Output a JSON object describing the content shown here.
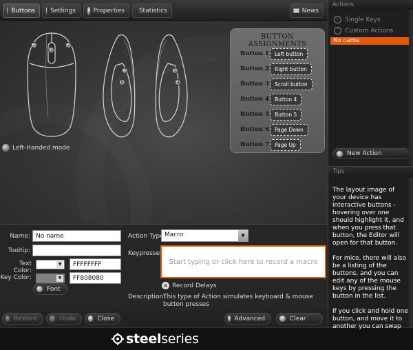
{
  "toolbar": {
    "tabs": [
      {
        "label": "Buttons",
        "active": true
      },
      {
        "label": "Settings",
        "active": false
      },
      {
        "label": "Properties",
        "active": false
      },
      {
        "label": "Statistics",
        "active": false
      }
    ],
    "news_label": "News"
  },
  "mouse_markers": {
    "top": [
      "1",
      "3",
      "2"
    ],
    "left_side": [
      "7",
      "6"
    ],
    "right_side": [
      "5",
      "4"
    ]
  },
  "assignments": {
    "title": "BUTTON ASSIGNMENTS",
    "rows": [
      {
        "label": "Button 1",
        "value": "Left button"
      },
      {
        "label": "Button 2",
        "value": "Right button"
      },
      {
        "label": "Button 3",
        "value": "Scroll button"
      },
      {
        "label": "Button 4",
        "value": "Button 4"
      },
      {
        "label": "Button 5",
        "value": "Button 5"
      },
      {
        "label": "Button 6",
        "value": "Page Down"
      },
      {
        "label": "Button 7",
        "value": "Page Up"
      }
    ]
  },
  "left_handed_label": "Left-Handed mode",
  "form": {
    "name_label": "Name:",
    "name_value": "No name",
    "tooltip_label": "Tooltip:",
    "tooltip_value": "",
    "text_color_label": "Text Color:",
    "text_color_value": "FFFFFFFF",
    "key_color_label": "Key Color:",
    "key_color_value": "FF808080",
    "font_label": "Font",
    "action_type_label": "Action Type",
    "action_type_value": "Macro",
    "keypresses_label": "Keypresses:",
    "keypresses_placeholder": "Start typing or click here to record a macro",
    "record_delays_label": "Record Delays",
    "description_label": "Description:",
    "description_text": "This type of Action simulates keyboard & mouse button presses"
  },
  "bottom": {
    "restore": "Restore",
    "undo": "Undo",
    "close": "Close",
    "advanced": "Advanced",
    "clear": "Clear"
  },
  "brand": {
    "bold": "steel",
    "thin": "series"
  },
  "right_panel": {
    "actions_header": "Actions",
    "single_keys": "Single Keys",
    "custom_actions": "Custom Actions",
    "selected_action": "No name",
    "new_action": "New Action",
    "tips_header": "Tips",
    "tips": [
      "The layout image of your device has interactive buttons - hovering over one should highlight it, and when you press that button, the Editor will open for that button.",
      "For mice, there will also be a listing of the buttons, and you can edit any of the mouse keys by pressing the button in the list.",
      "If you click and hold one button, and move it to another you can swap"
    ]
  },
  "colors": {
    "accent": "#e05a10",
    "text_color_swatch": "#ffffff",
    "key_color_swatch": "#808080"
  }
}
